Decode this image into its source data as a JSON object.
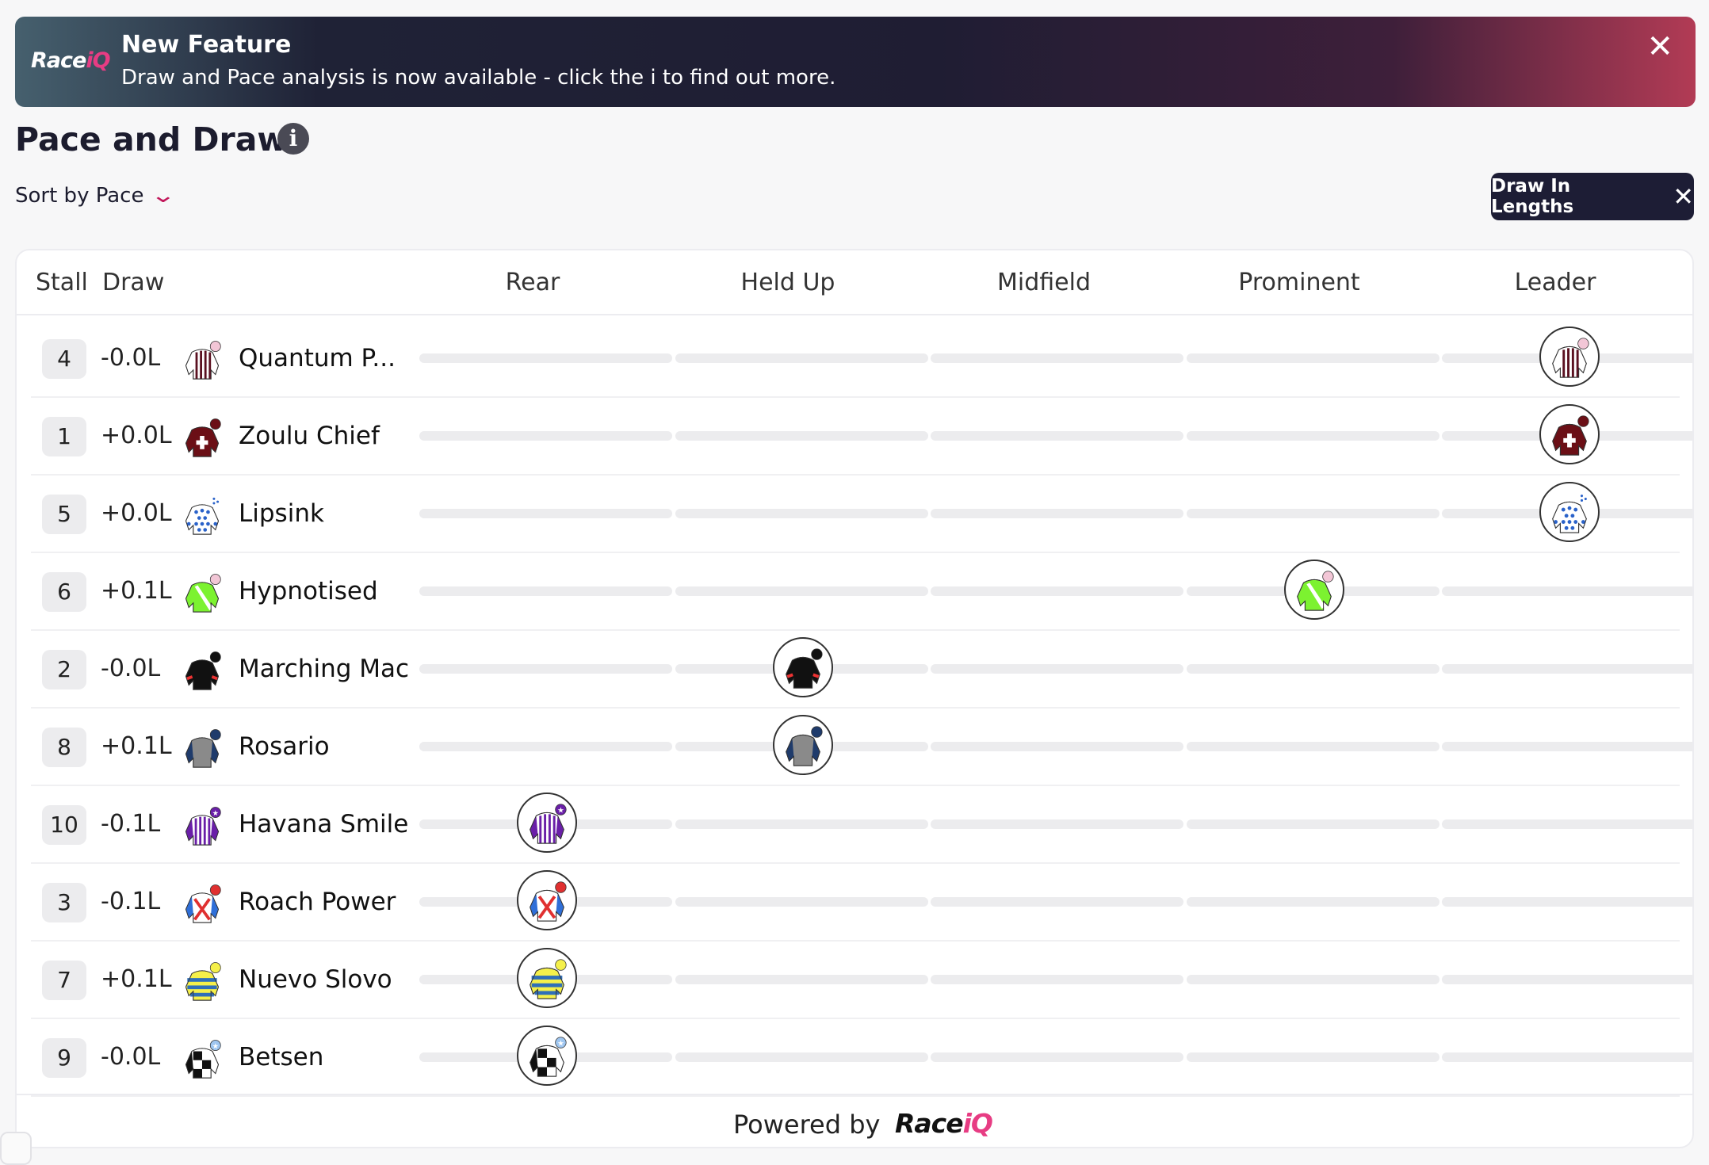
{
  "banner": {
    "logo_main": "Race",
    "logo_accent": "iQ",
    "title": "New Feature",
    "text": "Draw and Pace analysis is now available - click the i to find out more.",
    "close_icon": "close-icon"
  },
  "page": {
    "title": "Pace and Draw",
    "info_icon": "i"
  },
  "sort": {
    "label": "Sort by Pace",
    "icon": "chevron-down-icon"
  },
  "filter_chip": {
    "label": "Draw In Lengths",
    "icon": "close-icon"
  },
  "table": {
    "columns": {
      "stall": "Stall",
      "draw": "Draw"
    },
    "zones": [
      "Rear",
      "Held Up",
      "Midfield",
      "Prominent",
      "Leader"
    ],
    "rows": [
      {
        "stall": "4",
        "draw": "-0.0L",
        "name": "Quantum P...",
        "position": "Leader",
        "silk": "silk-stripes-maroon-pink"
      },
      {
        "stall": "1",
        "draw": "+0.0L",
        "name": "Zoulu Chief",
        "position": "Leader",
        "silk": "silk-maroon-cross"
      },
      {
        "stall": "5",
        "draw": "+0.0L",
        "name": "Lipsink",
        "position": "Leader",
        "silk": "silk-white-blue-spots"
      },
      {
        "stall": "6",
        "draw": "+0.1L",
        "name": "Hypnotised",
        "position": "Prominent",
        "silk": "silk-green-white-sash"
      },
      {
        "stall": "2",
        "draw": "-0.0L",
        "name": "Marching Mac",
        "position": "Held Up",
        "silk": "silk-black-red-armbands"
      },
      {
        "stall": "8",
        "draw": "+0.1L",
        "name": "Rosario",
        "position": "Held Up",
        "silk": "silk-grey-navy-sleeves"
      },
      {
        "stall": "10",
        "draw": "-0.1L",
        "name": "Havana Smile",
        "position": "Rear",
        "silk": "silk-purple-white-stripes"
      },
      {
        "stall": "3",
        "draw": "-0.1L",
        "name": "Roach Power",
        "position": "Rear",
        "silk": "silk-white-red-crossbelts"
      },
      {
        "stall": "7",
        "draw": "+0.1L",
        "name": "Nuevo Slovo",
        "position": "Rear",
        "silk": "silk-yellow-blue-hoops"
      },
      {
        "stall": "9",
        "draw": "-0.0L",
        "name": "Betsen",
        "position": "Rear",
        "silk": "silk-black-white-check"
      }
    ]
  },
  "footer": {
    "powered_by": "Powered by",
    "logo_main": "Race",
    "logo_accent": "iQ"
  }
}
